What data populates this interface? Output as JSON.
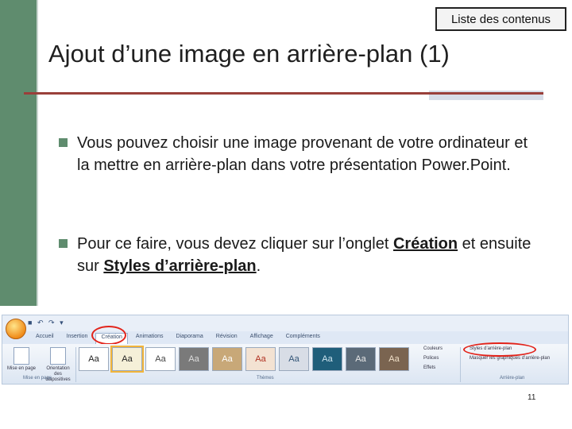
{
  "nav": {
    "toc_label": "Liste des contenus"
  },
  "slide": {
    "title": "Ajout d’une image en arrière-plan (1)",
    "bullet1": "Vous pouvez choisir une image provenant de votre ordinateur et la mettre en arrière-plan dans votre présentation Power.Point.",
    "bullet2_prefix": "Pour ce faire, vous devez cliquer sur l’onglet ",
    "bullet2_link1": "Création",
    "bullet2_middle": " et ensuite sur ",
    "bullet2_link2": "Styles d’arrière-plan",
    "bullet2_suffix": ".",
    "page_number": "11"
  },
  "ribbon": {
    "tabs": [
      "Accueil",
      "Insertion",
      "Création",
      "Animations",
      "Diaporama",
      "Révision",
      "Affichage",
      "Compléments"
    ],
    "active_tab": "Création",
    "page_buttons": [
      "Mise en page",
      "Orientation des diapositives"
    ],
    "group_page": "Mise en page",
    "group_themes": "Thèmes",
    "group_background": "Arrière-plan",
    "theme_options": [
      "Couleurs",
      "Polices",
      "Effets"
    ],
    "background_options": [
      "Styles d’arrière-plan",
      "Masquer les graphiques d’arrière-plan"
    ],
    "themes": [
      {
        "label": "Aa",
        "bg": "#ffffff",
        "fg": "#222222"
      },
      {
        "label": "Aa",
        "bg": "#f5f0d8",
        "fg": "#222222"
      },
      {
        "label": "Aa",
        "bg": "#ffffff",
        "fg": "#444444"
      },
      {
        "label": "Aa",
        "bg": "#7a7a7a",
        "fg": "#dddddd"
      },
      {
        "label": "Aa",
        "bg": "#c8a878",
        "fg": "#ffffff"
      },
      {
        "label": "Aa",
        "bg": "#f3e2d2",
        "fg": "#b03020"
      },
      {
        "label": "Aa",
        "bg": "#d8dde6",
        "fg": "#335577"
      },
      {
        "label": "Aa",
        "bg": "#1f5e7a",
        "fg": "#cfe6f0"
      },
      {
        "label": "Aa",
        "bg": "#5b6a78",
        "fg": "#e8e8e8"
      },
      {
        "label": "Aa",
        "bg": "#7a6450",
        "fg": "#f0e0c8"
      }
    ]
  },
  "colors": {
    "accent_green": "#5f8c6e",
    "rule_red": "#9a3f3a",
    "highlight_red": "#e2231a"
  }
}
